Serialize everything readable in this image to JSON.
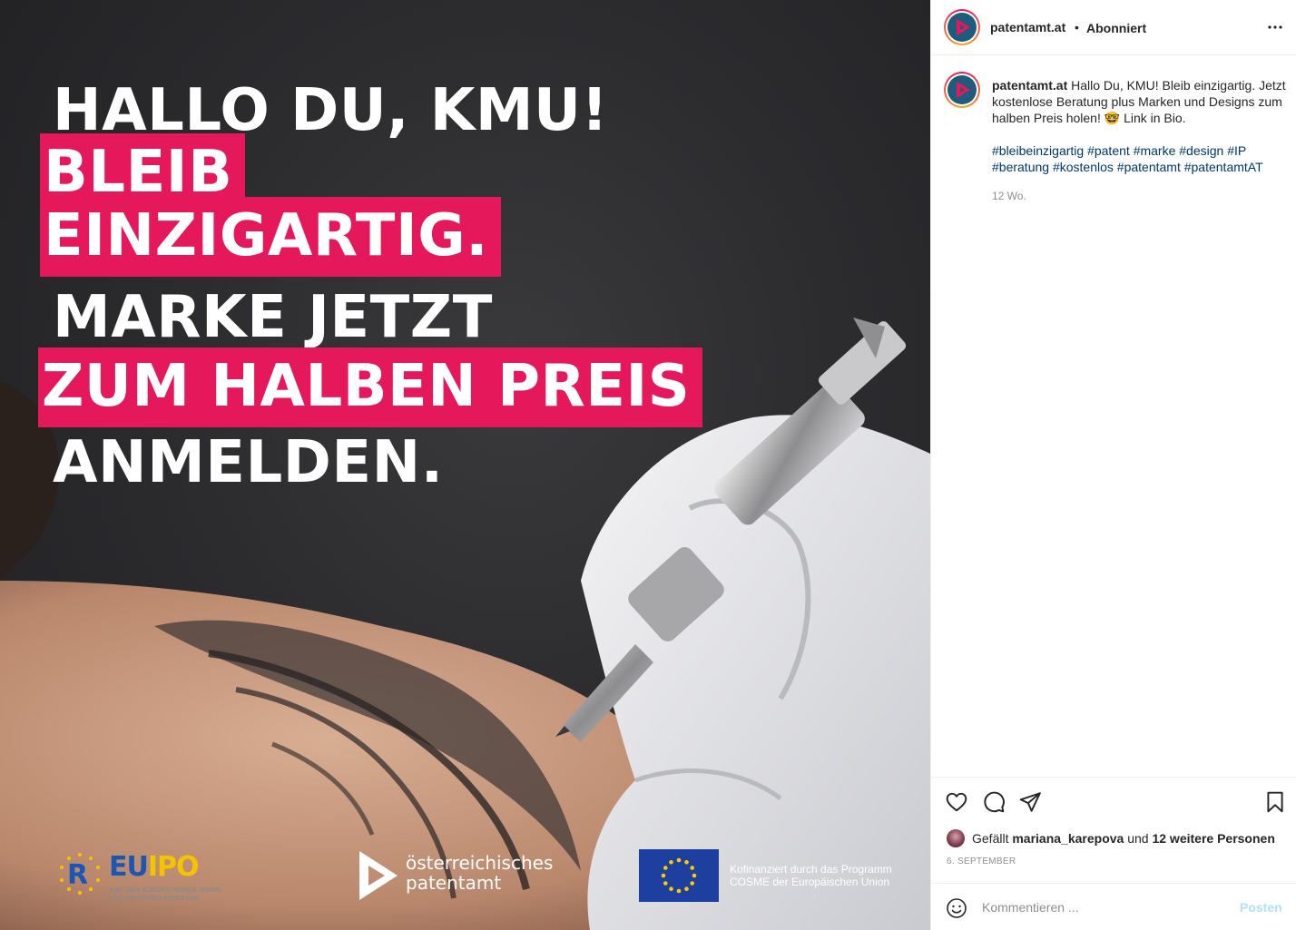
{
  "image": {
    "headline": {
      "line1": "HALLO DU, KMU!",
      "line2": "BLEIB",
      "line3": "EINZIGARTIG.",
      "line4": "MARKE JETZT",
      "line5": "ZUM HALBEN PREIS",
      "line6": "ANMELDEN."
    },
    "accent_color": "#e6185c",
    "logos": {
      "euipo_name": "EUIPO",
      "euipo_subtitle": "AMT DER EUROPÄISCHEN UNION FÜR GEISTIGES EIGENTUM",
      "patentamt_line1": "österreichisches",
      "patentamt_line2": "patentamt",
      "eu_text_line1": "Kofinanziert durch das Programm",
      "eu_text_line2": "COSME der Europäischen Union"
    }
  },
  "header": {
    "username": "patentamt.at",
    "separator": "•",
    "follow_status": "Abonniert",
    "more_icon": "more-horizontal-icon"
  },
  "caption": {
    "username": "patentamt.at",
    "text": "Hallo Du, KMU! Bleib einzigartig. Jetzt kostenlose Beratung plus Marken und Designs zum halben Preis holen! 🤓 Link in Bio.",
    "hashtags": [
      "#bleibeinzigartig",
      "#patent",
      "#marke",
      "#design",
      "#IP",
      "#beratung",
      "#kostenlos",
      "#patentamt",
      "#patentamtAT"
    ],
    "age": "12 Wo."
  },
  "actions": {
    "icons": [
      "heart-icon",
      "comment-icon",
      "share-icon",
      "bookmark-icon"
    ]
  },
  "likes": {
    "prefix": "Gefällt",
    "user": "mariana_karepova",
    "middle": "und",
    "others": "12 weitere Personen"
  },
  "date": "6. SEPTEMBER",
  "comment_box": {
    "placeholder": "Kommentieren ...",
    "post_label": "Posten"
  },
  "colors": {
    "link": "#00376b",
    "muted": "#8e8e8e",
    "post_disabled": "#b2dffc"
  }
}
